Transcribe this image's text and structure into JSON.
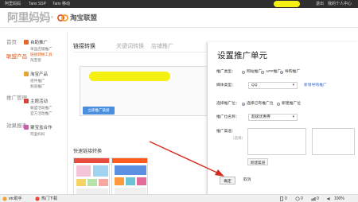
{
  "topbar": {
    "links": [
      "阿里妈妈",
      "Tanx SSP",
      "Tanx 移动"
    ],
    "logout": "退出",
    "user_center": "我的个人中心"
  },
  "header": {
    "brand_primary": "阿里妈妈",
    "brand_sep": "•",
    "brand_secondary": "淘宝联盟"
  },
  "sidebar": {
    "categories": [
      "首页",
      "联盟产品",
      "推广管理",
      "效果报表"
    ],
    "groups": [
      {
        "label": "自助推广",
        "color": "#e06a2c",
        "items": [
          "单品店铺推广",
          "链接转换工具",
          "淘宝客"
        ],
        "active": 1
      },
      {
        "label": "淘宝产品",
        "color": "#e8a23a",
        "items": [
          "组件推广",
          "频道推广"
        ],
        "active": -1
      },
      {
        "label": "主题活动",
        "color": "#d9423a",
        "items": [
          "联盟活动推广",
          "官方活动推广"
        ],
        "active": -1
      },
      {
        "label": "聚宝盆合作",
        "color": "#c65fa8",
        "items": [
          "阿里妈妈"
        ],
        "active": -1
      }
    ]
  },
  "main": {
    "tabs": [
      "链接转换",
      "关键词转换",
      "店铺推广"
    ],
    "convert_button": "立即推广链接",
    "quick_title": "快速链接转换"
  },
  "modal": {
    "title": "设置推广单元",
    "promo_type_label": "推广类型：",
    "promo_type_options": [
      "网站推广",
      "APP推广",
      "导购推广"
    ],
    "promo_type_selected": 2,
    "media_type_label": "媒体类型：",
    "media_type_value": "QQ",
    "new_media_link": "新增导购推广",
    "slot_type_label": "选择推广位：",
    "slot_type_options": [
      "选择已有推广位",
      "新建推广位"
    ],
    "slot_type_selected": 0,
    "slot_name_label": "推广位名称：",
    "slot_name_value": "超级优惠券",
    "channel_label": "推广渠道：",
    "channel_hint": "（选填）",
    "new_channel_button": "新建渠道",
    "confirm_button": "确定",
    "cancel_button": "取消"
  },
  "taskbar": {
    "left_app": "etc助手",
    "download": "热门下载",
    "items": [
      "0",
      "0",
      "0",
      "100%"
    ]
  },
  "colors": {
    "accent": "#e05a17",
    "primary_blue": "#4a8fde",
    "arrow": "#d42b20",
    "highlight": "#f6ef12"
  }
}
